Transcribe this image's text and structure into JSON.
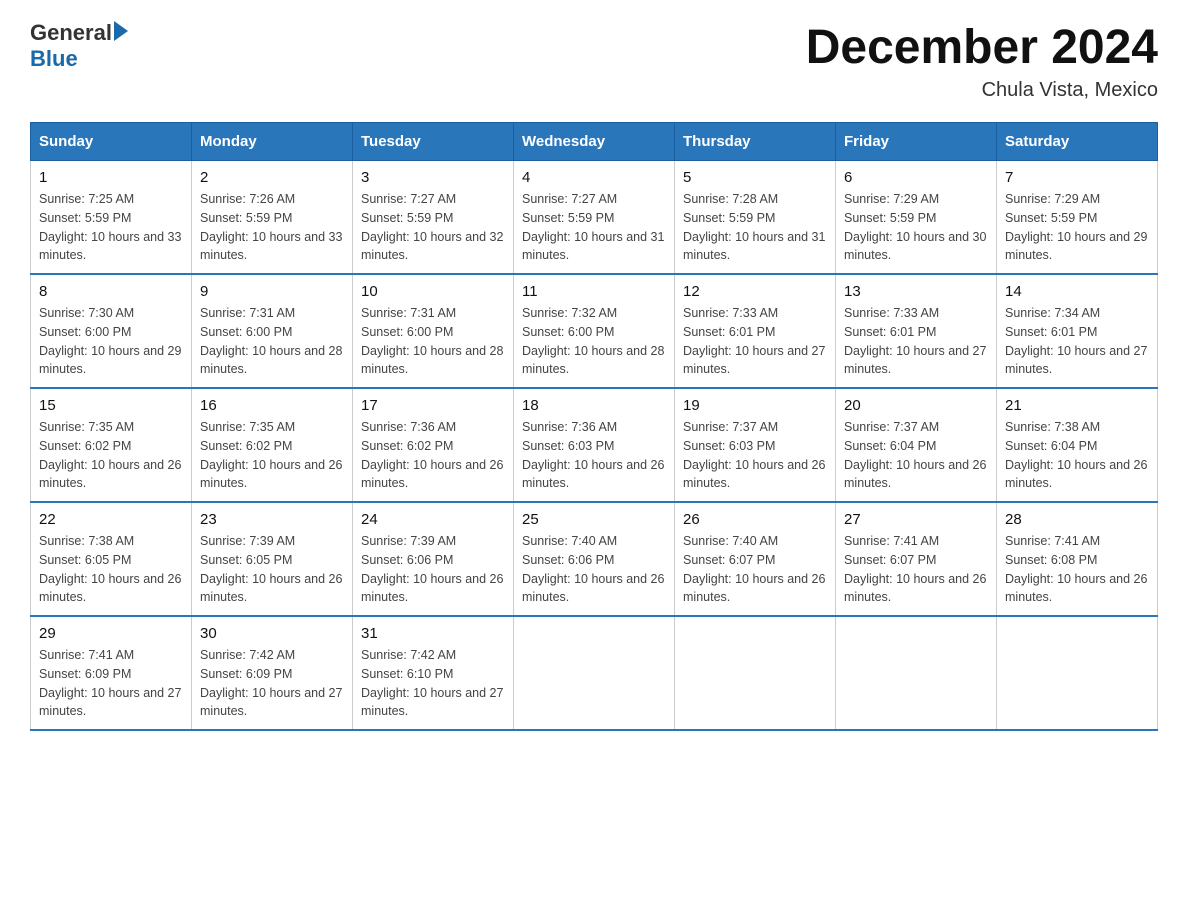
{
  "header": {
    "logo_general": "General",
    "logo_blue": "Blue",
    "month_title": "December 2024",
    "location": "Chula Vista, Mexico"
  },
  "days_of_week": [
    "Sunday",
    "Monday",
    "Tuesday",
    "Wednesday",
    "Thursday",
    "Friday",
    "Saturday"
  ],
  "weeks": [
    [
      {
        "day": "1",
        "sunrise": "Sunrise: 7:25 AM",
        "sunset": "Sunset: 5:59 PM",
        "daylight": "Daylight: 10 hours and 33 minutes."
      },
      {
        "day": "2",
        "sunrise": "Sunrise: 7:26 AM",
        "sunset": "Sunset: 5:59 PM",
        "daylight": "Daylight: 10 hours and 33 minutes."
      },
      {
        "day": "3",
        "sunrise": "Sunrise: 7:27 AM",
        "sunset": "Sunset: 5:59 PM",
        "daylight": "Daylight: 10 hours and 32 minutes."
      },
      {
        "day": "4",
        "sunrise": "Sunrise: 7:27 AM",
        "sunset": "Sunset: 5:59 PM",
        "daylight": "Daylight: 10 hours and 31 minutes."
      },
      {
        "day": "5",
        "sunrise": "Sunrise: 7:28 AM",
        "sunset": "Sunset: 5:59 PM",
        "daylight": "Daylight: 10 hours and 31 minutes."
      },
      {
        "day": "6",
        "sunrise": "Sunrise: 7:29 AM",
        "sunset": "Sunset: 5:59 PM",
        "daylight": "Daylight: 10 hours and 30 minutes."
      },
      {
        "day": "7",
        "sunrise": "Sunrise: 7:29 AM",
        "sunset": "Sunset: 5:59 PM",
        "daylight": "Daylight: 10 hours and 29 minutes."
      }
    ],
    [
      {
        "day": "8",
        "sunrise": "Sunrise: 7:30 AM",
        "sunset": "Sunset: 6:00 PM",
        "daylight": "Daylight: 10 hours and 29 minutes."
      },
      {
        "day": "9",
        "sunrise": "Sunrise: 7:31 AM",
        "sunset": "Sunset: 6:00 PM",
        "daylight": "Daylight: 10 hours and 28 minutes."
      },
      {
        "day": "10",
        "sunrise": "Sunrise: 7:31 AM",
        "sunset": "Sunset: 6:00 PM",
        "daylight": "Daylight: 10 hours and 28 minutes."
      },
      {
        "day": "11",
        "sunrise": "Sunrise: 7:32 AM",
        "sunset": "Sunset: 6:00 PM",
        "daylight": "Daylight: 10 hours and 28 minutes."
      },
      {
        "day": "12",
        "sunrise": "Sunrise: 7:33 AM",
        "sunset": "Sunset: 6:01 PM",
        "daylight": "Daylight: 10 hours and 27 minutes."
      },
      {
        "day": "13",
        "sunrise": "Sunrise: 7:33 AM",
        "sunset": "Sunset: 6:01 PM",
        "daylight": "Daylight: 10 hours and 27 minutes."
      },
      {
        "day": "14",
        "sunrise": "Sunrise: 7:34 AM",
        "sunset": "Sunset: 6:01 PM",
        "daylight": "Daylight: 10 hours and 27 minutes."
      }
    ],
    [
      {
        "day": "15",
        "sunrise": "Sunrise: 7:35 AM",
        "sunset": "Sunset: 6:02 PM",
        "daylight": "Daylight: 10 hours and 26 minutes."
      },
      {
        "day": "16",
        "sunrise": "Sunrise: 7:35 AM",
        "sunset": "Sunset: 6:02 PM",
        "daylight": "Daylight: 10 hours and 26 minutes."
      },
      {
        "day": "17",
        "sunrise": "Sunrise: 7:36 AM",
        "sunset": "Sunset: 6:02 PM",
        "daylight": "Daylight: 10 hours and 26 minutes."
      },
      {
        "day": "18",
        "sunrise": "Sunrise: 7:36 AM",
        "sunset": "Sunset: 6:03 PM",
        "daylight": "Daylight: 10 hours and 26 minutes."
      },
      {
        "day": "19",
        "sunrise": "Sunrise: 7:37 AM",
        "sunset": "Sunset: 6:03 PM",
        "daylight": "Daylight: 10 hours and 26 minutes."
      },
      {
        "day": "20",
        "sunrise": "Sunrise: 7:37 AM",
        "sunset": "Sunset: 6:04 PM",
        "daylight": "Daylight: 10 hours and 26 minutes."
      },
      {
        "day": "21",
        "sunrise": "Sunrise: 7:38 AM",
        "sunset": "Sunset: 6:04 PM",
        "daylight": "Daylight: 10 hours and 26 minutes."
      }
    ],
    [
      {
        "day": "22",
        "sunrise": "Sunrise: 7:38 AM",
        "sunset": "Sunset: 6:05 PM",
        "daylight": "Daylight: 10 hours and 26 minutes."
      },
      {
        "day": "23",
        "sunrise": "Sunrise: 7:39 AM",
        "sunset": "Sunset: 6:05 PM",
        "daylight": "Daylight: 10 hours and 26 minutes."
      },
      {
        "day": "24",
        "sunrise": "Sunrise: 7:39 AM",
        "sunset": "Sunset: 6:06 PM",
        "daylight": "Daylight: 10 hours and 26 minutes."
      },
      {
        "day": "25",
        "sunrise": "Sunrise: 7:40 AM",
        "sunset": "Sunset: 6:06 PM",
        "daylight": "Daylight: 10 hours and 26 minutes."
      },
      {
        "day": "26",
        "sunrise": "Sunrise: 7:40 AM",
        "sunset": "Sunset: 6:07 PM",
        "daylight": "Daylight: 10 hours and 26 minutes."
      },
      {
        "day": "27",
        "sunrise": "Sunrise: 7:41 AM",
        "sunset": "Sunset: 6:07 PM",
        "daylight": "Daylight: 10 hours and 26 minutes."
      },
      {
        "day": "28",
        "sunrise": "Sunrise: 7:41 AM",
        "sunset": "Sunset: 6:08 PM",
        "daylight": "Daylight: 10 hours and 26 minutes."
      }
    ],
    [
      {
        "day": "29",
        "sunrise": "Sunrise: 7:41 AM",
        "sunset": "Sunset: 6:09 PM",
        "daylight": "Daylight: 10 hours and 27 minutes."
      },
      {
        "day": "30",
        "sunrise": "Sunrise: 7:42 AM",
        "sunset": "Sunset: 6:09 PM",
        "daylight": "Daylight: 10 hours and 27 minutes."
      },
      {
        "day": "31",
        "sunrise": "Sunrise: 7:42 AM",
        "sunset": "Sunset: 6:10 PM",
        "daylight": "Daylight: 10 hours and 27 minutes."
      },
      null,
      null,
      null,
      null
    ]
  ]
}
